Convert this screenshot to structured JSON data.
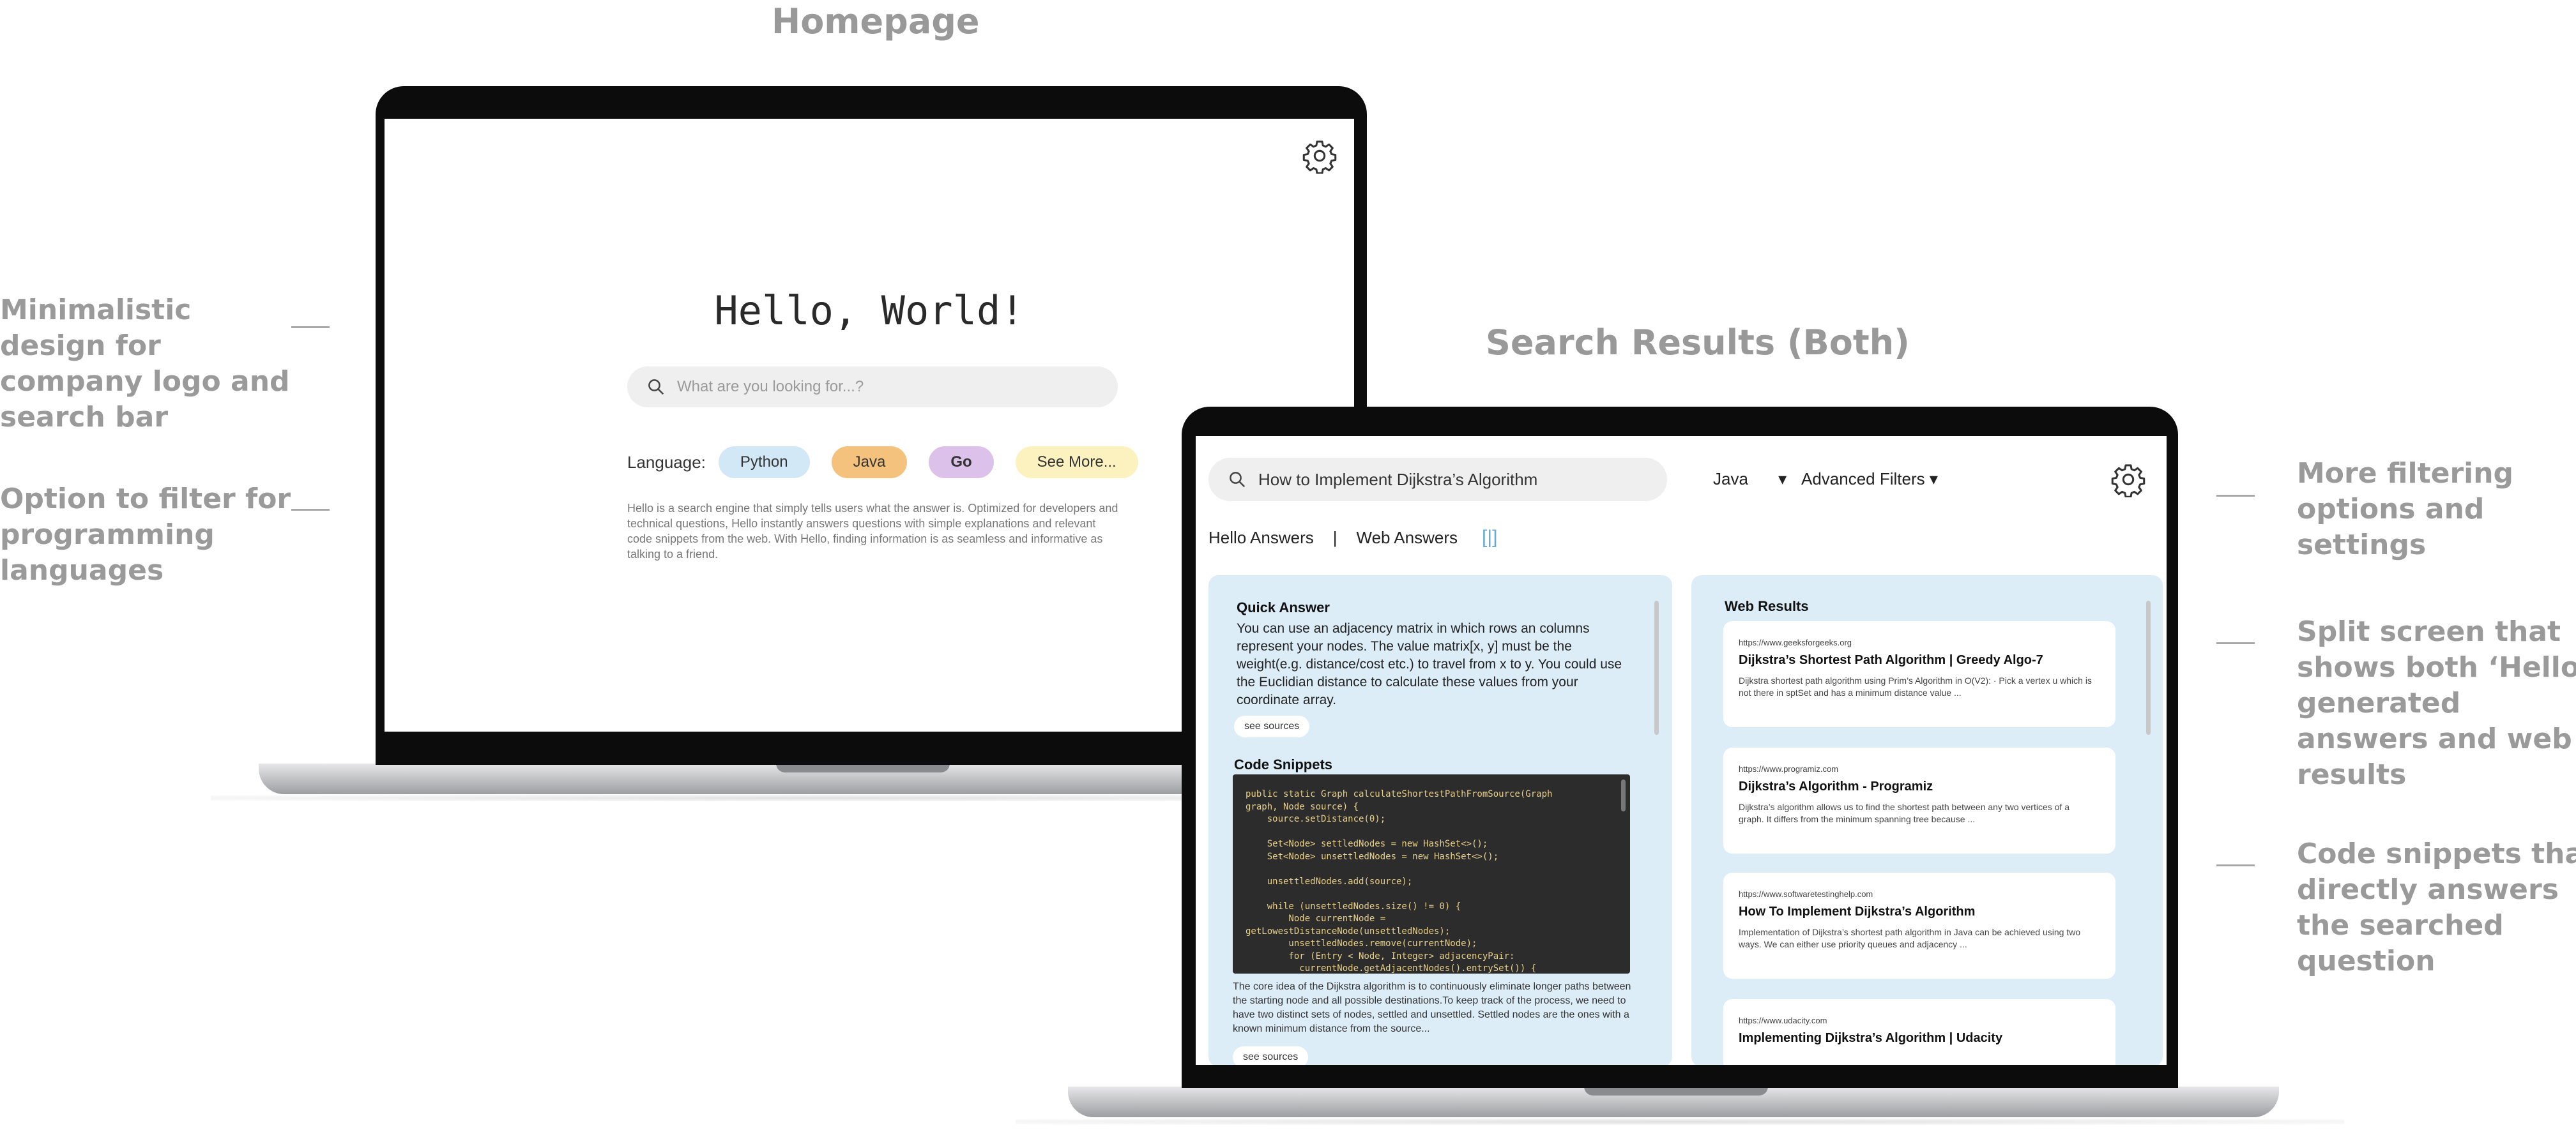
{
  "sections": {
    "homepage_title": "Homepage",
    "results_title": "Search Results (Both)"
  },
  "annotations": {
    "left": [
      "Minimalistic\ndesign for\ncompany logo and\nsearch bar",
      "Option to filter for\nprogramming\nlanguages"
    ],
    "right": [
      "More filtering\noptions and\nsettings",
      "Split screen that\nshows both ‘Hello’\ngenerated\nanswers and web\nresults",
      "Code snippets that\ndirectly answers\nthe searched\nquestion"
    ]
  },
  "homepage": {
    "logo_text": "Hello, World!",
    "search_placeholder": "What are you looking for...?",
    "language_label": "Language:",
    "language_chips": [
      {
        "label": "Python",
        "color": "#d3e8f6"
      },
      {
        "label": "Java",
        "color": "#f4c27c"
      },
      {
        "label": "Go",
        "color": "#dcc2ea"
      },
      {
        "label": "See More...",
        "color": "#fbf2bf"
      }
    ],
    "description": "Hello is a search engine that simply tells users what the answer is. Optimized for developers and technical questions, Hello instantly answers questions with simple explanations and relevant code snippets from the web. With Hello, finding information is as seamless and informative as talking to a friend."
  },
  "results": {
    "query": "How to Implement Dijkstra’s Algorithm",
    "language_filter": "Java",
    "language_caret": "▾",
    "advanced_filters": "Advanced Filters ▾",
    "tab_hello": "Hello Answers",
    "tab_separator": "|",
    "tab_web": "Web Answers",
    "split_icon": "[|]",
    "quick_answer_title": "Quick Answer",
    "quick_answer_text": "You can use an adjacency matrix in which rows an columns represent your nodes. The value matrix[x, y] must be the weight(e.g. distance/cost etc.) to travel from x to y. You could use the Euclidian distance to calculate these values from your coordinate array.",
    "see_sources": "see sources",
    "see_sources_2": "see sources",
    "code_title": "Code Snippets",
    "code": "public static Graph calculateShortestPathFromSource(Graph\ngraph, Node source) {\n    source.setDistance(0);\n\n    Set<Node> settledNodes = new HashSet<>();\n    Set<Node> unsettledNodes = new HashSet<>();\n\n    unsettledNodes.add(source);\n\n    while (unsettledNodes.size() != 0) {\n        Node currentNode =\ngetLowestDistanceNode(unsettledNodes);\n        unsettledNodes.remove(currentNode);\n        for (Entry < Node, Integer> adjacencyPair:\n          currentNode.getAdjacentNodes().entrySet()) {",
    "core_text": "The core idea of the Dijkstra algorithm is to continuously eliminate longer paths between the starting node and all possible destinations.To keep track of the process, we need to have two distinct sets of nodes, settled and unsettled. Settled nodes are the ones with a known minimum distance from the source...",
    "web_title": "Web Results",
    "web_results": [
      {
        "url": "https://www.geeksforgeeks.org",
        "title": "Dijkstra’s Shortest Path Algorithm | Greedy Algo-7",
        "snippet": "Dijkstra shortest path algorithm using Prim’s Algorithm in O(V2): · Pick a vertex u which is not there in sptSet and has a minimum distance value ..."
      },
      {
        "url": "https://www.programiz.com",
        "title": "Dijkstra’s Algorithm - Programiz",
        "snippet": "Dijkstra’s algorithm allows us to find the shortest path between any two vertices of a graph. It differs from the minimum spanning tree because ..."
      },
      {
        "url": "https://www.softwaretestinghelp.com",
        "title": "How To Implement Dijkstra’s Algorithm",
        "snippet": "Implementation of Dijkstra’s shortest path algorithm in Java can be achieved using two ways. We can either use priority queues and adjacency ..."
      },
      {
        "url": "https://www.udacity.com",
        "title": "Implementing Dijkstra’s Algorithm | Udacity",
        "snippet": ""
      }
    ]
  }
}
